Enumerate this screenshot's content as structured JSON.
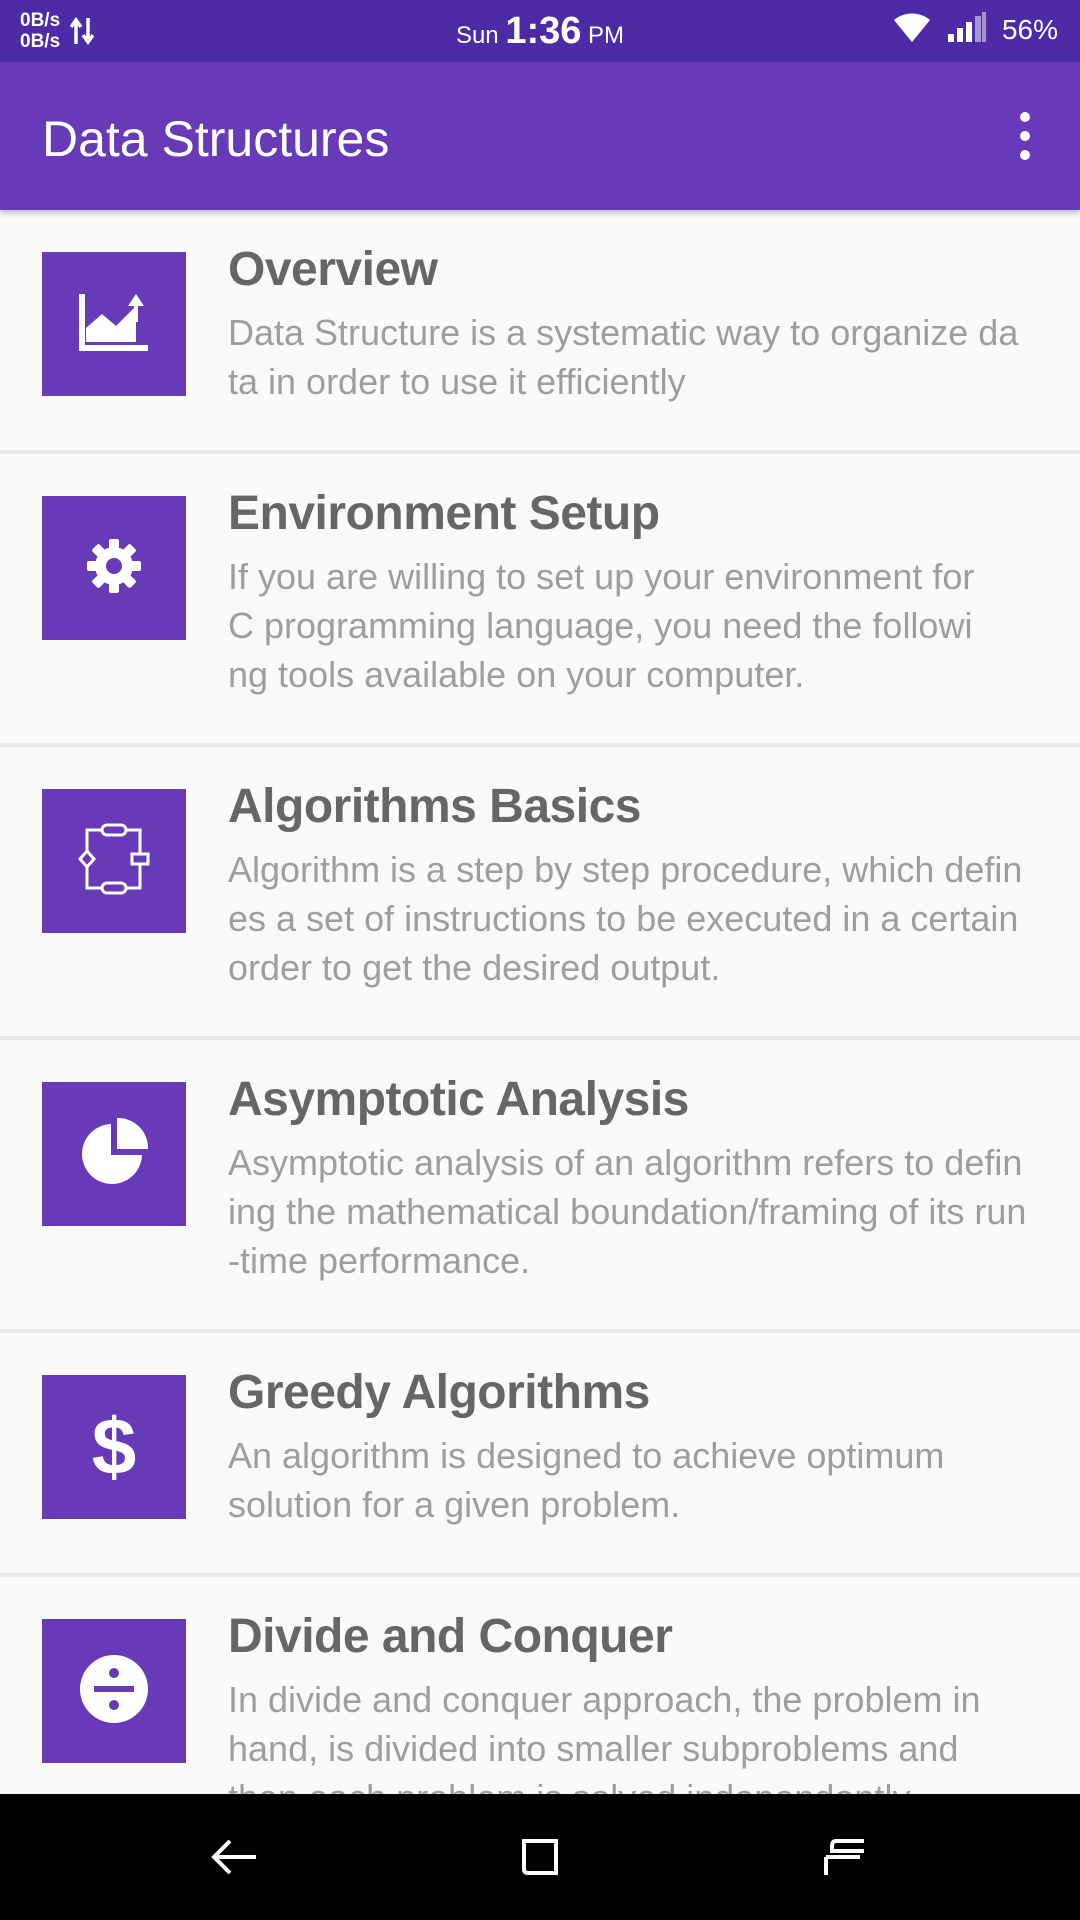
{
  "status_bar": {
    "speed_up": "0B/s",
    "speed_down": "0B/s",
    "day": "Sun",
    "time": "1:36",
    "ampm": "PM",
    "battery": "56%"
  },
  "app_bar": {
    "title": "Data Structures"
  },
  "colors": {
    "primary": "#673ab7",
    "primary_dark": "#4d2ba6",
    "title_text": "#666666",
    "desc_text": "#9e9e9e"
  },
  "items": [
    {
      "icon": "chart-icon",
      "title": "Overview",
      "desc": "Data Structure is a systematic way to organize data in order to use it efficiently"
    },
    {
      "icon": "gear-icon",
      "title": "Environment Setup",
      "desc": "If you are  willing to set up your environment for C programming language, you need the following tools available on your computer."
    },
    {
      "icon": "flowchart-icon",
      "title": "Algorithms Basics",
      "desc": "Algorithm is a step by step procedure, which defines a set of instructions to be executed in a certain order to get the desired output."
    },
    {
      "icon": "pie-chart-icon",
      "title": "Asymptotic Analysis",
      "desc": "Asymptotic analysis of an algorithm refers to defining the mathematical boundation/framing of its run-time performance."
    },
    {
      "icon": "dollar-icon",
      "title": "Greedy Algorithms",
      "desc": "An  algorithm  is  designed  to  achieve optimum  solution  for  a  given  problem."
    },
    {
      "icon": "divide-icon",
      "title": "Divide and Conquer",
      "desc": "In divide and conquer approach, the problem in hand, is divided into smaller subproblems and then each problem is solved independently."
    }
  ]
}
